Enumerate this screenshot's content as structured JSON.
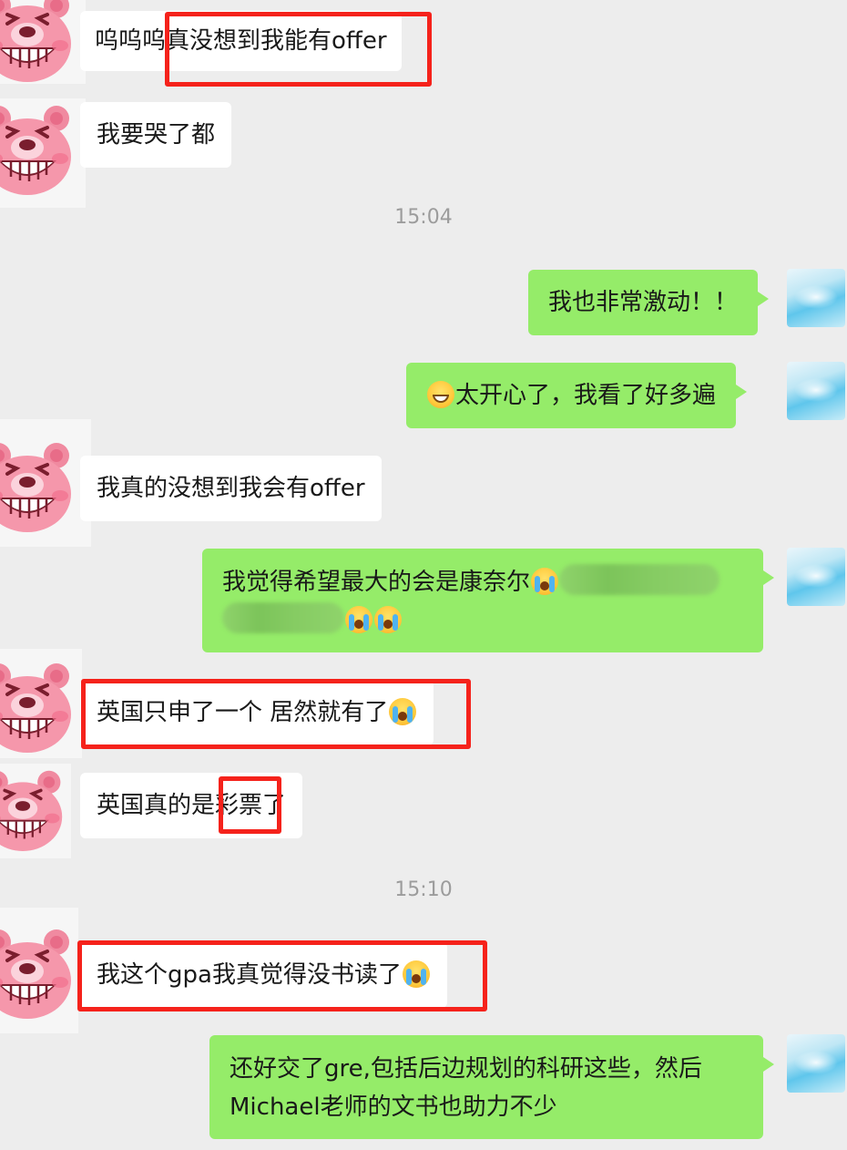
{
  "messages": [
    {
      "text": "呜呜呜真没想到我能有offer"
    },
    {
      "text": "我要哭了都"
    },
    {
      "time": "15:04"
    },
    {
      "text": "我也非常激动！！"
    },
    {
      "emoji": "grinning-face",
      "text": "太开心了，我看了好多遍"
    },
    {
      "text": "我真的没想到我会有offer"
    },
    {
      "line1": "我觉得希望最大的会是康奈尔",
      "emoji": "loudly-crying-face"
    },
    {
      "text": "英国只申了一个 居然就有了",
      "emoji": "loudly-crying-face"
    },
    {
      "text": "英国真的是彩票了"
    },
    {
      "time": "15:10"
    },
    {
      "text": "我这个gpa我真觉得没书读了",
      "emoji": "loudly-crying-face"
    },
    {
      "line1": "还好交了gre,包括后边规划的科研这些，然后",
      "line2": "Michael老师的文书也助力不少"
    }
  ],
  "colors": {
    "background": "#ededed",
    "incoming_bubble": "#ffffff",
    "outgoing_bubble": "#95ec69",
    "highlight_box": "#f5221b",
    "timestamp": "#9c9c9c"
  }
}
